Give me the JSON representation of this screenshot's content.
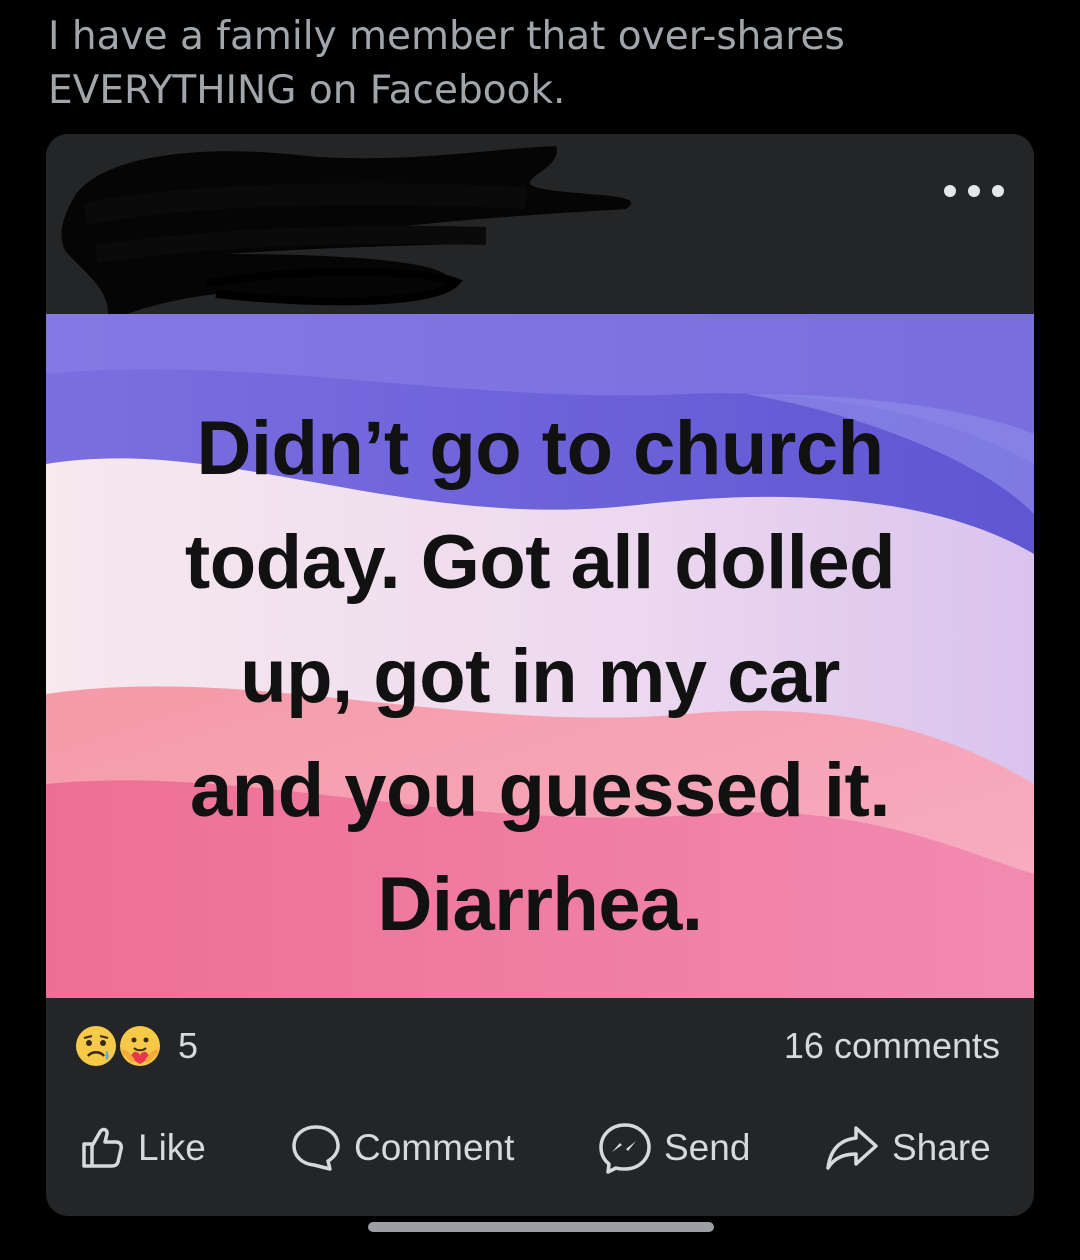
{
  "tweet": {
    "text": "I have a family member that over-shares\nEVERYTHING on Facebook."
  },
  "post": {
    "author_redacted": true,
    "more_icon": "more-horizontal-icon",
    "message": "Didn’t go to church\ntoday. Got all dolled\nup, got in my car\nand you guessed it.\nDiarrhea.",
    "background_colors": [
      "#6f63d6",
      "#e9d6ec",
      "#ee7ba1"
    ],
    "reactions": {
      "icons": [
        "sad-reaction-icon",
        "care-reaction-icon"
      ],
      "count": "5"
    },
    "comments_label": "16 comments",
    "actions": {
      "like": "Like",
      "comment": "Comment",
      "send": "Send",
      "share": "Share"
    }
  },
  "colors": {
    "page_background": "#000000",
    "card_background": "#242526",
    "text_secondary": "#d6d9dd",
    "tweet_text": "#a0a6ab"
  }
}
